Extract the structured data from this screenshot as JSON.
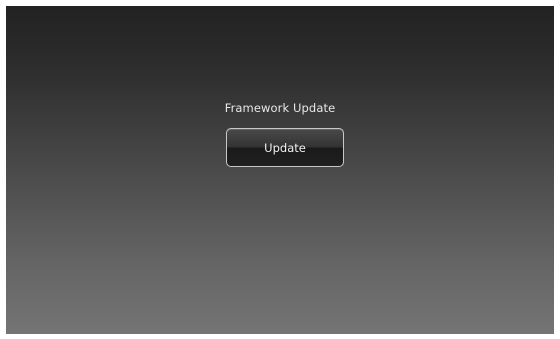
{
  "dialog": {
    "title": "Framework Update",
    "update_button_label": "Update"
  }
}
